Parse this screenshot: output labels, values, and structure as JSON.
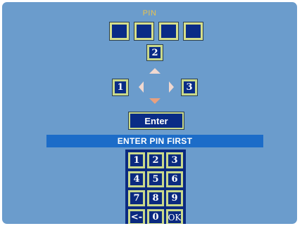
{
  "header": {
    "title": "PIN"
  },
  "pin_boxes": [
    "",
    "",
    "",
    ""
  ],
  "nav": {
    "up_key": "2",
    "left_key": "1",
    "right_key": "3"
  },
  "enter_label": "Enter",
  "status_message": "ENTER PIN FIRST",
  "keypad": {
    "k1": "1",
    "k2": "2",
    "k3": "3",
    "k4": "4",
    "k5": "5",
    "k6": "6",
    "k7": "7",
    "k8": "8",
    "k9": "9",
    "back": "<-",
    "k0": "0",
    "ok": "OK"
  },
  "colors": {
    "background": "#6b9ccc",
    "key_fill": "#0a2c86",
    "key_border": "#c9d98a",
    "title": "#e8c250",
    "status_bar": "#1c6cc8",
    "arrow": "#f0d8d0",
    "arrow_active": "#e8a07e"
  }
}
